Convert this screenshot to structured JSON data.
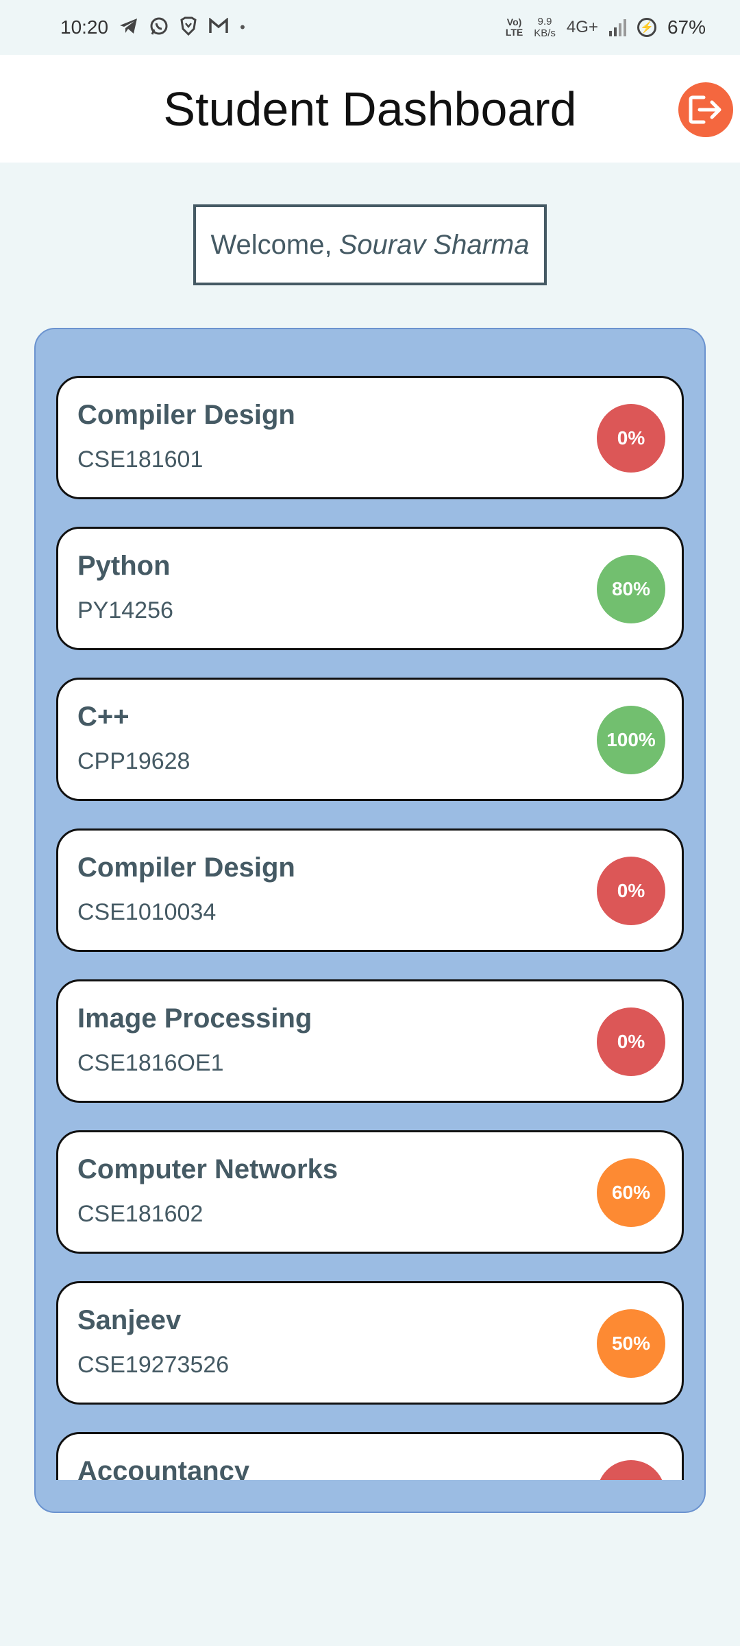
{
  "status_bar": {
    "time": "10:20",
    "left_icons": [
      "telegram-icon",
      "whatsapp-icon",
      "brave-icon",
      "gmail-icon"
    ],
    "dot": "•",
    "volte_top": "Vo)",
    "volte_bottom": "LTE",
    "speed_value": "9.9",
    "speed_unit": "KB/s",
    "network": "4G+",
    "battery": "67%"
  },
  "header": {
    "title": "Student Dashboard",
    "logout_icon": "logout-icon"
  },
  "welcome": {
    "prefix": "Welcome,",
    "name": "Sourav Sharma"
  },
  "colors": {
    "low": "#dc5757",
    "mid": "#fd8a33",
    "high": "#72bf6f"
  },
  "courses": [
    {
      "name": "Compiler Design",
      "code": "CSE181601",
      "progress": "0%",
      "level": "low"
    },
    {
      "name": "Python",
      "code": "PY14256",
      "progress": "80%",
      "level": "high"
    },
    {
      "name": "C++",
      "code": "CPP19628",
      "progress": "100%",
      "level": "high"
    },
    {
      "name": "Compiler Design",
      "code": "CSE1010034",
      "progress": "0%",
      "level": "low"
    },
    {
      "name": "Image Processing",
      "code": "CSE1816OE1",
      "progress": "0%",
      "level": "low"
    },
    {
      "name": "Computer Networks",
      "code": "CSE181602",
      "progress": "60%",
      "level": "mid"
    },
    {
      "name": "Sanjeev",
      "code": "CSE19273526",
      "progress": "50%",
      "level": "mid"
    },
    {
      "name": "Accountancy",
      "code": "",
      "progress": "",
      "level": "low"
    }
  ]
}
